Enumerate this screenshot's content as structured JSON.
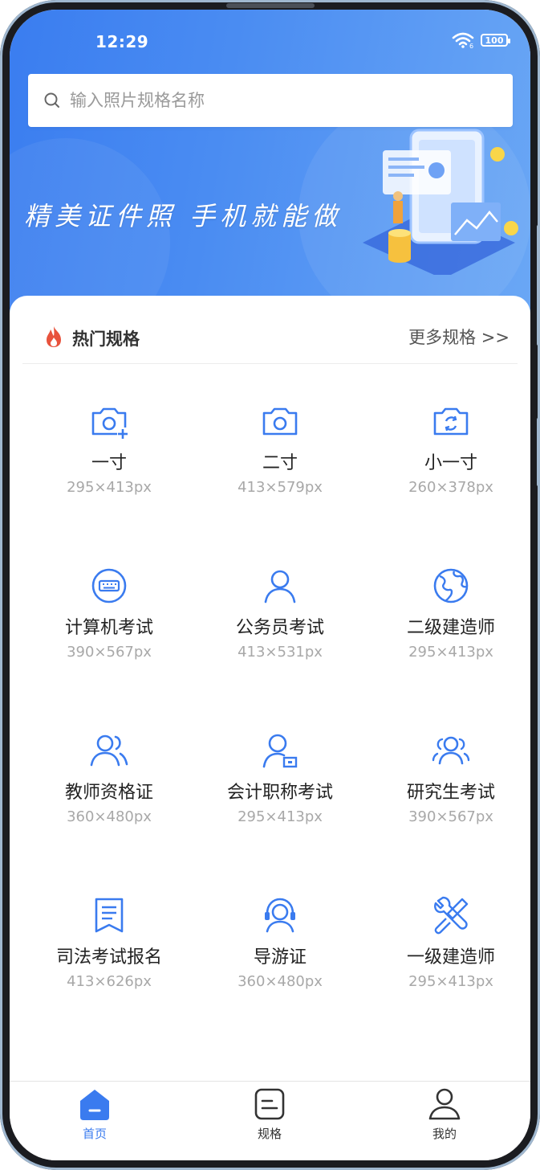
{
  "status_bar": {
    "time": "12:29",
    "battery": "100"
  },
  "search": {
    "placeholder": "输入照片规格名称"
  },
  "banner": {
    "slogan": "精美证件照 手机就能做"
  },
  "section": {
    "title": "热门规格",
    "more": "更多规格 >>"
  },
  "specs": [
    {
      "icon": "camera-plus-icon",
      "name": "一寸",
      "size": "295×413px"
    },
    {
      "icon": "camera-icon",
      "name": "二寸",
      "size": "413×579px"
    },
    {
      "icon": "camera-rotate-icon",
      "name": "小一寸",
      "size": "260×378px"
    },
    {
      "icon": "keyboard-icon",
      "name": "计算机考试",
      "size": "390×567px"
    },
    {
      "icon": "user-icon",
      "name": "公务员考试",
      "size": "413×531px"
    },
    {
      "icon": "globe-icon",
      "name": "二级建造师",
      "size": "295×413px"
    },
    {
      "icon": "users-icon",
      "name": "教师资格证",
      "size": "360×480px"
    },
    {
      "icon": "user-card-icon",
      "name": "会计职称考试",
      "size": "295×413px"
    },
    {
      "icon": "group-icon",
      "name": "研究生考试",
      "size": "390×567px"
    },
    {
      "icon": "bookmark-document-icon",
      "name": "司法考试报名",
      "size": "413×626px"
    },
    {
      "icon": "headset-user-icon",
      "name": "导游证",
      "size": "360×480px"
    },
    {
      "icon": "tools-icon",
      "name": "一级建造师",
      "size": "295×413px"
    }
  ],
  "tabs": [
    {
      "label": "首页",
      "icon": "home-icon",
      "active": true
    },
    {
      "label": "规格",
      "icon": "spec-document-icon",
      "active": false
    },
    {
      "label": "我的",
      "icon": "profile-icon",
      "active": false
    }
  ],
  "colors": {
    "accent": "#3a7bef",
    "muted_text": "#a8a8a8",
    "tab_inactive": "#333333"
  }
}
